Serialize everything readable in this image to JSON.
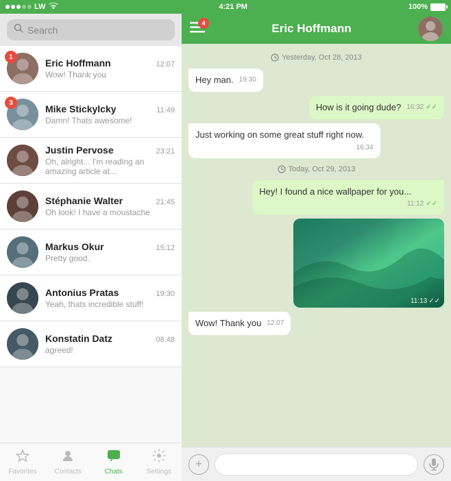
{
  "statusBar": {
    "carrier": "LW",
    "time": "4:21 PM",
    "battery": "100%",
    "wifiIcon": "wifi",
    "signalDots": 3
  },
  "leftPanel": {
    "search": {
      "placeholder": "Search",
      "iconLabel": "search-icon"
    },
    "chats": [
      {
        "id": 1,
        "name": "Eric Hoffmann",
        "time": "12:07",
        "preview": "Wow! Thank you",
        "badge": 1,
        "avatarColor": "#8d6e63"
      },
      {
        "id": 2,
        "name": "Mike Stickylcky",
        "time": "11:49",
        "preview": "Damn! Thats awesome!",
        "badge": 3,
        "avatarColor": "#78909c"
      },
      {
        "id": 3,
        "name": "Justin Pervose",
        "time": "23:21",
        "preview": "Oh, alright... I'm reading an amazing article at...",
        "badge": 0,
        "avatarColor": "#6d4c41"
      },
      {
        "id": 4,
        "name": "Stéphanie Walter",
        "time": "21:45",
        "preview": "Oh look! I have a moustache",
        "badge": 0,
        "avatarColor": "#5d4037"
      },
      {
        "id": 5,
        "name": "Markus Okur",
        "time": "15:12",
        "preview": "Pretty good.",
        "badge": 0,
        "avatarColor": "#546e7a"
      },
      {
        "id": 6,
        "name": "Antonius Pratas",
        "time": "19:30",
        "preview": "Yeah, thats incredible stuff!",
        "badge": 0,
        "avatarColor": "#37474f"
      },
      {
        "id": 7,
        "name": "Konstatin Datz",
        "time": "08.48",
        "preview": "agreed!",
        "badge": 0,
        "avatarColor": "#455a64"
      }
    ],
    "tabs": [
      {
        "id": "favorites",
        "label": "Favorites",
        "icon": "★",
        "active": false
      },
      {
        "id": "contacts",
        "label": "Contacts",
        "icon": "👤",
        "active": false
      },
      {
        "id": "chats",
        "label": "Chats",
        "icon": "💬",
        "active": true
      },
      {
        "id": "settings",
        "label": "Settings",
        "icon": "⚙",
        "active": false
      }
    ]
  },
  "rightPanel": {
    "header": {
      "title": "Eric Hoffmann",
      "menuBadge": 4
    },
    "messages": [
      {
        "id": 1,
        "type": "date",
        "text": "Yesterday, Oct 28, 2013"
      },
      {
        "id": 2,
        "type": "incoming",
        "text": "Hey man.",
        "time": "19:30"
      },
      {
        "id": 3,
        "type": "outgoing",
        "text": "How is it going dude?",
        "time": "16:32",
        "ticks": "✓✓"
      },
      {
        "id": 4,
        "type": "incoming",
        "text": "Just working on some great stuff right now.",
        "time": "16:34"
      },
      {
        "id": 5,
        "type": "date",
        "text": "Today, Oct 29, 2013"
      },
      {
        "id": 6,
        "type": "outgoing",
        "text": "Hey! I found a nice wallpaper for you...",
        "time": "11:12",
        "ticks": "✓✓"
      },
      {
        "id": 7,
        "type": "outgoing-image",
        "time": "11:13",
        "ticks": "✓✓"
      },
      {
        "id": 8,
        "type": "incoming",
        "text": "Wow! Thank you",
        "time": "12:07"
      }
    ],
    "inputBar": {
      "placeholder": "",
      "addLabel": "+",
      "micLabel": "🎤"
    }
  }
}
